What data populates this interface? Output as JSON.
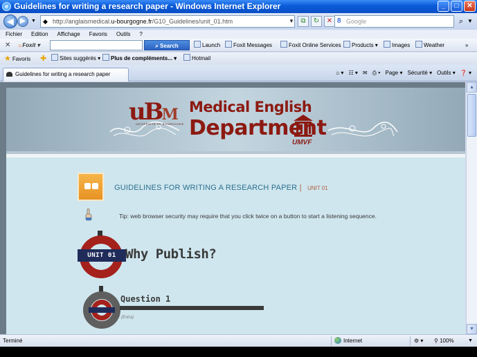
{
  "window": {
    "title": "Guidelines for writing a research paper - Windows Internet Explorer",
    "min_glyph": "_",
    "max_glyph": "□",
    "close_glyph": "✕"
  },
  "address": {
    "url_prefix": "http://anglaismedical.",
    "url_domain": "u-bourgogne.fr",
    "url_suffix": "/G10_Guidelines/unit_01.htm",
    "search_placeholder": "Google"
  },
  "menu": [
    "Fichier",
    "Edition",
    "Affichage",
    "Favoris",
    "Outils",
    "?"
  ],
  "foxit_bar": {
    "logo": "Foxit",
    "search_button": "Search",
    "items": [
      "Launch",
      "Foxit Messages",
      "Foxit Online Services",
      "Products",
      "Images",
      "Weather"
    ]
  },
  "favorites_bar": {
    "favorites_label": "Favoris",
    "items": [
      "Sites suggérés",
      "Plus de compléments...",
      "Hotmail"
    ]
  },
  "tab": {
    "label": "Guidelines for writing a research paper"
  },
  "command_bar": [
    "Page",
    "Sécurité",
    "Outils"
  ],
  "page": {
    "logo_text": "uB",
    "logo_suffix": "M",
    "logo_subtitle": "UNIVERSITÉ DE BOURGOGNE",
    "dept_line1": "Medical English",
    "dept_line2": "Department",
    "umvf_label": "UMVF",
    "guide_title": "GUIDELINES FOR WRITING A RESEARCH PAPER",
    "guide_separator": "|",
    "guide_unit": "UNIT 01",
    "tip": "Tip: web browser security may require that you click twice on a button to start a listening sequence.",
    "unit_roundel": "UNIT 01",
    "section_title": "Why Publish?",
    "question_title": "Question 1",
    "question_sub": "(Extra)"
  },
  "status": {
    "text": "Terminé",
    "zone": "Internet",
    "zoom": "100%"
  }
}
